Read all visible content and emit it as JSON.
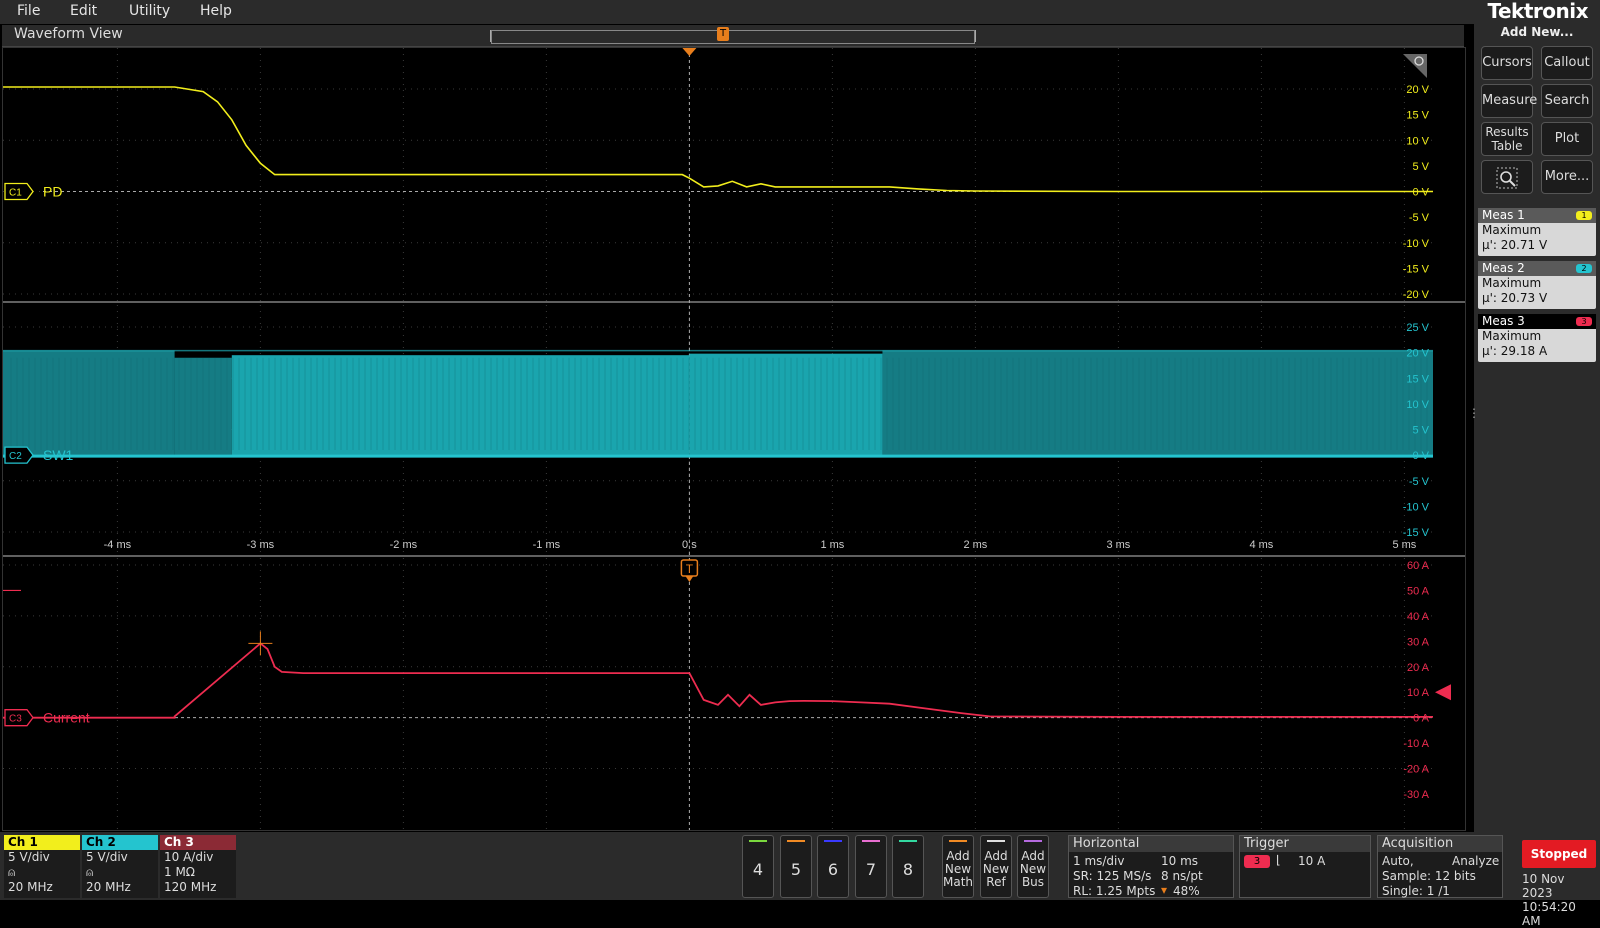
{
  "menu": {
    "items": [
      "File",
      "Edit",
      "Utility",
      "Help"
    ]
  },
  "brand": {
    "logo": "Tektronix"
  },
  "waveform_view": {
    "title": "Waveform View",
    "trigger_marker": "T"
  },
  "right_panel": {
    "add_new": "Add New...",
    "buttons": [
      {
        "label": "Cursors"
      },
      {
        "label": "Callout"
      },
      {
        "label": "Measure"
      },
      {
        "label": "Search"
      },
      {
        "label": "Results Table"
      },
      {
        "label": "Plot"
      },
      {
        "label": "More..."
      }
    ],
    "measurements": [
      {
        "name": "Meas 1",
        "channel": "1",
        "type": "Maximum",
        "value": "µ': 20.71 V",
        "color": "#f2ee1c"
      },
      {
        "name": "Meas 2",
        "channel": "2",
        "type": "Maximum",
        "value": "µ': 20.73 V",
        "color": "#24c4cf"
      },
      {
        "name": "Meas 3",
        "channel": "3",
        "type": "Maximum",
        "value": "µ': 29.18 A",
        "color": "#ee2c50"
      }
    ]
  },
  "channels": {
    "c1": {
      "tag": "C1",
      "label": "PD",
      "color": "#f2ee1c",
      "ticks": [
        "20 V",
        "15 V",
        "10 V",
        "5 V",
        "0 V",
        "-5 V",
        "-10 V",
        "-15 V",
        "-20 V"
      ]
    },
    "c2": {
      "tag": "C2",
      "label": "SW1",
      "color": "#24c4cf",
      "ticks": [
        "25 V",
        "20 V",
        "15 V",
        "10 V",
        "5 V",
        "0 V",
        "-5 V",
        "-10 V",
        "-15 V"
      ]
    },
    "c3": {
      "tag": "C3",
      "label": "Current",
      "color": "#ee2c50",
      "ticks": [
        "60 A",
        "50 A",
        "40 A",
        "30 A",
        "20 A",
        "10 A",
        "0 A",
        "-10 A",
        "-20 A",
        "-30 A"
      ]
    }
  },
  "time_axis": {
    "ticks": [
      "-4 ms",
      "-3 ms",
      "-2 ms",
      "-1 ms",
      "0 s",
      "1 ms",
      "2 ms",
      "3 ms",
      "4 ms",
      "5 ms"
    ]
  },
  "chart_data": {
    "type": "line",
    "x_unit": "ms",
    "xlim": [
      -4.8,
      5.2
    ],
    "grid": true,
    "series": [
      {
        "name": "PD",
        "unit": "V",
        "ylim": [
          -20,
          20
        ],
        "x": [
          -4.8,
          -3.6,
          -3.4,
          -3.3,
          -3.2,
          -3.1,
          -3.0,
          -2.9,
          -0.05,
          0.0,
          0.1,
          0.2,
          0.3,
          0.4,
          0.5,
          0.6,
          0.7,
          0.8,
          1.0,
          1.4,
          1.6,
          1.8,
          2.0,
          3.0,
          5.2
        ],
        "y": [
          20.4,
          20.4,
          19.5,
          17.5,
          14,
          9,
          5.5,
          3.3,
          3.3,
          2.6,
          0.9,
          1.1,
          2.0,
          0.9,
          1.5,
          0.9,
          0.9,
          0.9,
          0.9,
          0.9,
          0.5,
          0.2,
          0.1,
          0.0,
          0.0
        ]
      },
      {
        "name": "SW1",
        "unit": "V",
        "ylim": [
          -15,
          25
        ],
        "low": 0,
        "high": 20,
        "segments": [
          {
            "from": -4.8,
            "to": -3.6,
            "high": 20.4,
            "shade": "dark"
          },
          {
            "from": -3.6,
            "to": -3.2,
            "high": 19.0,
            "shade": "dark"
          },
          {
            "from": -3.2,
            "to": 0.0,
            "high": 19.5,
            "shade": "bright"
          },
          {
            "from": 0.0,
            "to": 1.35,
            "high": 19.8,
            "shade": "bright"
          },
          {
            "from": 1.35,
            "to": 5.2,
            "high": 20.4,
            "shade": "dark"
          }
        ]
      },
      {
        "name": "Current",
        "unit": "A",
        "ylim": [
          -30,
          60
        ],
        "x": [
          -4.8,
          -3.6,
          -3.6,
          -3.0,
          -2.95,
          -2.9,
          -2.85,
          -2.7,
          -0.02,
          0.0,
          0.1,
          0.2,
          0.27,
          0.35,
          0.42,
          0.5,
          0.6,
          0.7,
          0.8,
          1.0,
          1.2,
          1.4,
          1.6,
          1.9,
          2.1,
          3.0,
          5.2
        ],
        "y": [
          0,
          0,
          0.5,
          29.2,
          27,
          20,
          18,
          17.5,
          17.5,
          17.5,
          7,
          5,
          9,
          4.5,
          9,
          5,
          6,
          6.5,
          6.6,
          6.5,
          6,
          5.5,
          4,
          1.8,
          0.5,
          0.3,
          0.3
        ]
      }
    ]
  },
  "bottom": {
    "ch1": {
      "title": "Ch 1",
      "scale": "5 V/div",
      "bw": "20 MHz",
      "color": "#f2ee1c"
    },
    "ch2": {
      "title": "Ch 2",
      "scale": "5 V/div",
      "bw": "20 MHz",
      "color": "#24c4cf"
    },
    "ch3": {
      "title": "Ch 3",
      "scale": "10 A/div",
      "impedance": "1 MΩ",
      "bw": "120 MHz",
      "color": "#ee2c50"
    },
    "channel_buttons": [
      {
        "label": "4",
        "color": "#7ad83e"
      },
      {
        "label": "5",
        "color": "#f08a24"
      },
      {
        "label": "6",
        "color": "#3a3aff"
      },
      {
        "label": "7",
        "color": "#e86ed0"
      },
      {
        "label": "8",
        "color": "#33d9a0"
      }
    ],
    "add_buttons": [
      {
        "label": "Add New Math",
        "color": "#f08a24"
      },
      {
        "label": "Add New Ref",
        "color": "#dddddd"
      },
      {
        "label": "Add New Bus",
        "color": "#b56adf"
      }
    ],
    "horizontal": {
      "title": "Horizontal",
      "scale": "1 ms/div",
      "duration": "10 ms",
      "sr": "SR: 125 MS/s",
      "period": "8 ns/pt",
      "rl": "RL: 1.25 Mpts",
      "position": "48%"
    },
    "trigger": {
      "title": "Trigger",
      "source": "3",
      "level": "10 A"
    },
    "acquisition": {
      "title": "Acquisition",
      "mode": "Auto,",
      "action": "Analyze",
      "sample": "Sample: 12 bits",
      "single": "Single: 1 /1"
    },
    "status": "Stopped",
    "date": "10 Nov 2023",
    "time": "10:54:20 AM"
  }
}
